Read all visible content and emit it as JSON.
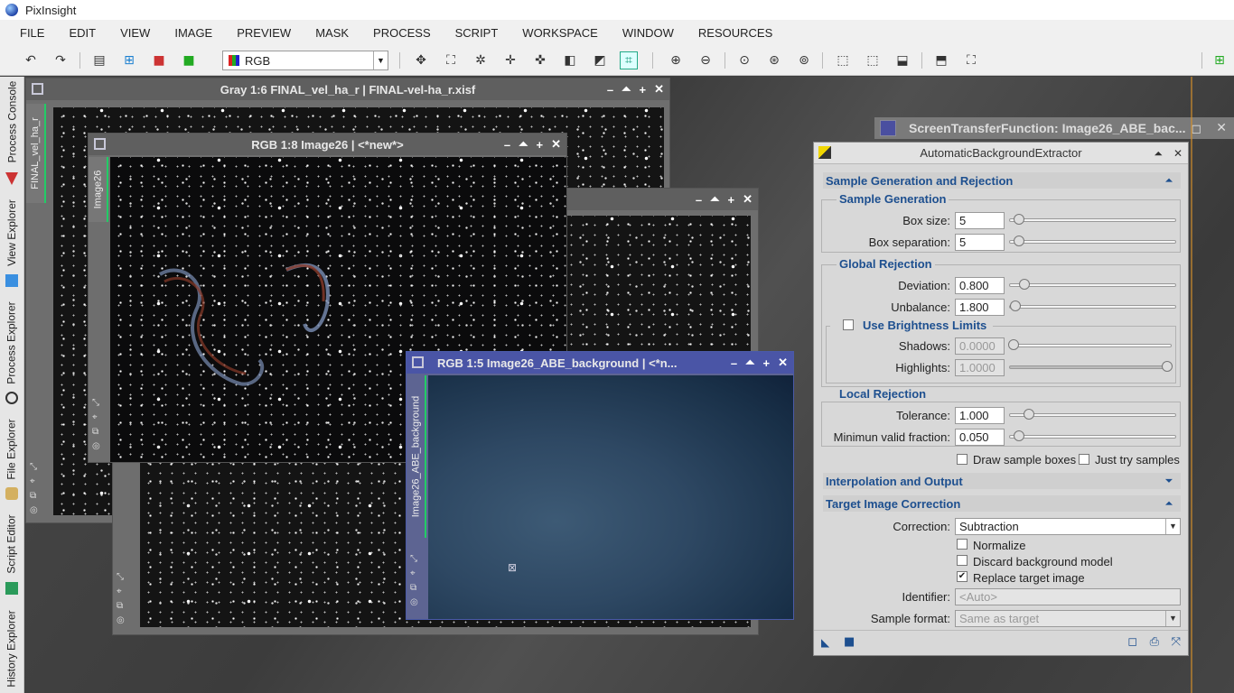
{
  "app": {
    "title": "PixInsight"
  },
  "menu": [
    "FILE",
    "EDIT",
    "VIEW",
    "IMAGE",
    "PREVIEW",
    "MASK",
    "PROCESS",
    "SCRIPT",
    "WORKSPACE",
    "WINDOW",
    "RESOURCES"
  ],
  "toolbar": {
    "color_mode": "RGB"
  },
  "sidebar": {
    "tabs": [
      "Process Console",
      "View Explorer",
      "Process Explorer",
      "File Explorer",
      "Script Editor",
      "History Explorer"
    ]
  },
  "windows": {
    "gray": {
      "title": "Gray 1:6 FINAL_vel_ha_r | FINAL-vel-ha_r.xisf",
      "tab": "FINAL_vel_ha_r"
    },
    "rgb26": {
      "title": "RGB 1:8 Image26 | <*new*>",
      "tab": "Image26"
    },
    "abe_bg": {
      "title": "RGB 1:5 Image26_ABE_background | <*n...",
      "tab": "Image26_ABE_background"
    }
  },
  "stf": {
    "title": "ScreenTransferFunction: Image26_ABE_bac..."
  },
  "abe": {
    "title": "AutomaticBackgroundExtractor",
    "sections": {
      "sample_gen_rej": "Sample Generation and Rejection",
      "interp_output": "Interpolation and Output",
      "target_correction": "Target Image Correction"
    },
    "sample_generation": {
      "label": "Sample Generation",
      "box_size_label": "Box size:",
      "box_size": "5",
      "box_sep_label": "Box separation:",
      "box_sep": "5"
    },
    "global_rejection": {
      "label": "Global Rejection",
      "deviation_label": "Deviation:",
      "deviation": "0.800",
      "unbalance_label": "Unbalance:",
      "unbalance": "1.800"
    },
    "brightness": {
      "label": "Use Brightness Limits",
      "shadows_label": "Shadows:",
      "shadows": "0.0000",
      "highlights_label": "Highlights:",
      "highlights": "1.0000"
    },
    "local_rejection": {
      "label": "Local Rejection",
      "tolerance_label": "Tolerance:",
      "tolerance": "1.000",
      "min_valid_label": "Minimun valid fraction:",
      "min_valid": "0.050"
    },
    "draw_boxes": "Draw sample boxes",
    "just_try": "Just try samples",
    "correction_label": "Correction:",
    "correction": "Subtraction",
    "normalize": "Normalize",
    "discard": "Discard background model",
    "replace": "Replace target image",
    "identifier_label": "Identifier:",
    "identifier_placeholder": "<Auto>",
    "sample_format_label": "Sample format:",
    "sample_format": "Same as target"
  }
}
